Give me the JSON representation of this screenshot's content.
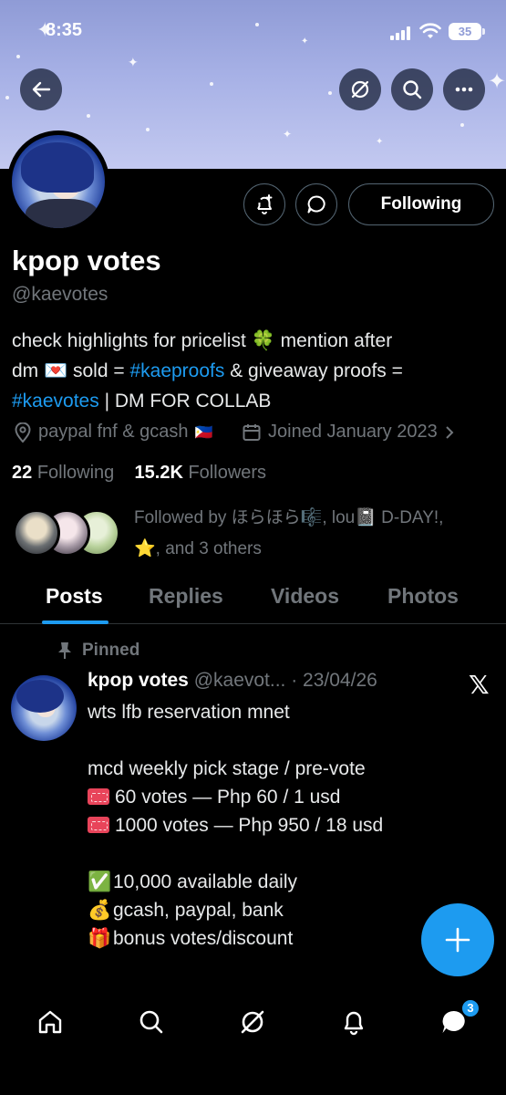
{
  "status_bar": {
    "time": "8:35",
    "battery": "35"
  },
  "profile": {
    "display_name": "kpop votes",
    "handle": "@kaevotes",
    "following_button": "Following",
    "bio": {
      "line1_text": "check highlights for pricelist ",
      "line1_emoji": "🍀",
      "line1_end": " mention after",
      "line2_start": "dm ",
      "line2_emoji": "💌",
      "line2_mid": " sold = ",
      "line2_link": "#kaeproofs",
      "line2_end": " & giveaway proofs =",
      "line3_link": "#kaevotes",
      "line3_end": " | DM FOR COLLAB"
    },
    "location": "paypal fnf & gcash",
    "location_flag": "🇵🇭",
    "joined": "Joined January 2023",
    "following_count": "22",
    "following_label": "Following",
    "followers_count": "15.2K",
    "followers_label": "Followers",
    "followed_by_line1": "Followed by ほらほら🎼, lou📓 D-DAY!,",
    "followed_by_line2": "⭐, and 3 others"
  },
  "tabs": [
    "Posts",
    "Replies",
    "Videos",
    "Photos"
  ],
  "pinned_post": {
    "pinned_label": "Pinned",
    "author": "kpop votes",
    "meta": "@kaevot... · 23/04/26",
    "lines": [
      "wts lfb reservation mnet",
      "",
      "mcd weekly pick stage / pre-vote",
      "60 votes — Php 60 / 1 usd",
      "1000 votes — Php 950 / 18 usd",
      "",
      "10,000 available daily",
      "gcash, paypal, bank",
      "bonus votes/discount"
    ],
    "emojis": {
      "check": "✅",
      "money": "💰",
      "gift": "🎁"
    }
  },
  "bottom_nav": {
    "messages_badge": "3"
  },
  "colors": {
    "accent": "#1d9bf0",
    "muted": "#71767b",
    "background": "#000000"
  }
}
